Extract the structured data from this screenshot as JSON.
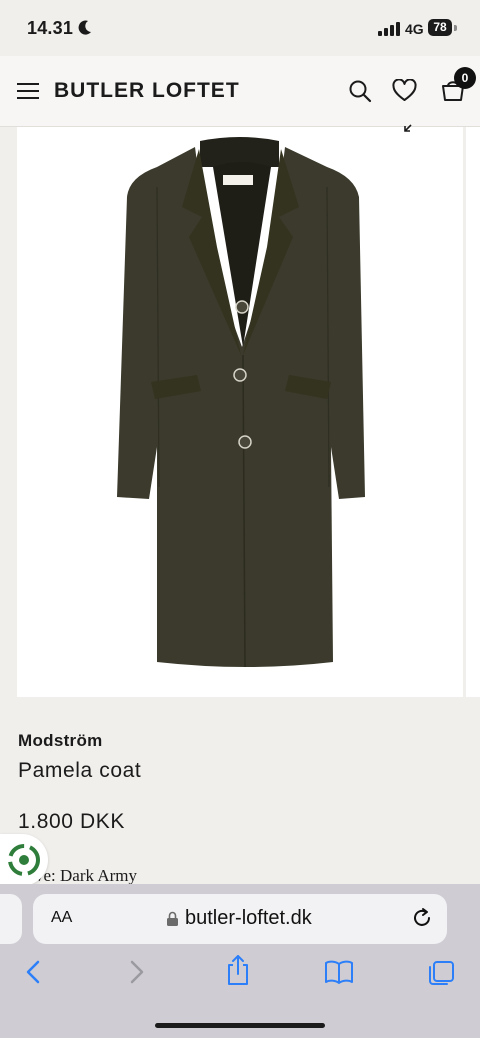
{
  "status_bar": {
    "time": "14.31",
    "network": "4G",
    "battery": "78"
  },
  "header": {
    "brand": "BUTLER LOFTET",
    "cart_count": "0"
  },
  "product": {
    "brand": "Modström",
    "name": "Pamela coat",
    "price": "1.800 DKK",
    "color_partial": "…ve: Dark Army",
    "image_description_icon": "coat-image",
    "coat_color": "#3b3a2c"
  },
  "browser": {
    "aa_label": "AA",
    "url": "butler-loftet.dk"
  },
  "colors": {
    "accent_blue": "#2d7ff9",
    "bg": "#f1efec"
  }
}
